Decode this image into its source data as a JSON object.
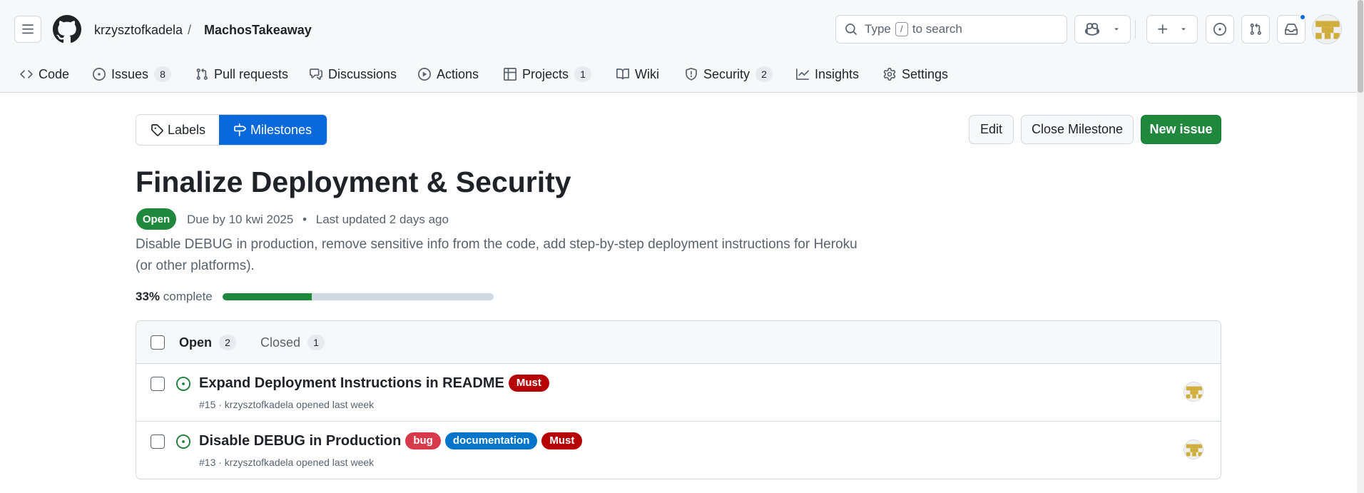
{
  "repo": {
    "owner": "krzysztofkadela",
    "separator": "/",
    "name": "MachosTakeaway"
  },
  "search": {
    "prefix": "Type",
    "key": "/",
    "suffix": "to search"
  },
  "nav": {
    "tabs": [
      {
        "label": "Code",
        "icon": "code-icon"
      },
      {
        "label": "Issues",
        "icon": "issue-opened-icon",
        "count": "8"
      },
      {
        "label": "Pull requests",
        "icon": "git-pull-request-icon"
      },
      {
        "label": "Discussions",
        "icon": "comment-discussion-icon"
      },
      {
        "label": "Actions",
        "icon": "play-icon"
      },
      {
        "label": "Projects",
        "icon": "table-icon",
        "count": "1"
      },
      {
        "label": "Wiki",
        "icon": "book-icon"
      },
      {
        "label": "Security",
        "icon": "shield-icon",
        "count": "2"
      },
      {
        "label": "Insights",
        "icon": "graph-icon"
      },
      {
        "label": "Settings",
        "icon": "gear-icon"
      }
    ]
  },
  "subnav": {
    "labels": "Labels",
    "milestones": "Milestones"
  },
  "actions": {
    "edit": "Edit",
    "close": "Close Milestone",
    "new_issue": "New issue"
  },
  "milestone": {
    "title": "Finalize Deployment & Security",
    "state": "Open",
    "due": "Due by 10 kwi 2025",
    "bullet": "•",
    "updated": "Last updated 2 days ago",
    "description": "Disable DEBUG in production, remove sensitive info from the code, add step-by-step deployment instructions for Heroku (or other platforms).",
    "percent": "33%",
    "complete_label": "complete",
    "progress_fraction": 0.33
  },
  "issues_box": {
    "open_label": "Open",
    "open_count": "2",
    "closed_label": "Closed",
    "closed_count": "1",
    "issues": [
      {
        "title": "Expand Deployment Instructions in README",
        "meta": "#15 · krzysztofkadela opened last week",
        "labels": [
          {
            "name": "Must",
            "color": "#b60205"
          }
        ]
      },
      {
        "title": "Disable DEBUG in Production",
        "meta": "#13 · krzysztofkadela opened last week",
        "labels": [
          {
            "name": "bug",
            "color": "#d73a4a"
          },
          {
            "name": "documentation",
            "color": "#0075ca"
          },
          {
            "name": "Must",
            "color": "#b60205"
          }
        ]
      }
    ]
  },
  "colors": {
    "primary": "#1f883d",
    "accent": "#0969da",
    "border": "#d1d9e0"
  }
}
